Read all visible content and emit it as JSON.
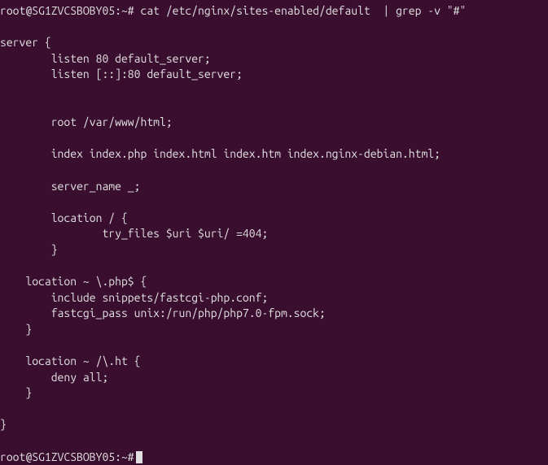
{
  "prompt1": "root@SG1ZVCSBOBY05:~#",
  "command1": " cat /etc/nginx/sites-enabled/default  | grep -v \"#\"",
  "output": {
    "line1": "server {",
    "line2": "        listen 80 default_server;",
    "line3": "        listen [::]:80 default_server;",
    "line4": "",
    "line5": "",
    "line6": "        root /var/www/html;",
    "line7": "",
    "line8": "        index index.php index.html index.htm index.nginx-debian.html;",
    "line9": "",
    "line10": "        server_name _;",
    "line11": "",
    "line12": "        location / {",
    "line13": "                try_files $uri $uri/ =404;",
    "line14": "        }",
    "line15": "",
    "line16": "    location ~ \\.php$ {",
    "line17": "        include snippets/fastcgi-php.conf;",
    "line18": "        fastcgi_pass unix:/run/php/php7.0-fpm.sock;",
    "line19": "    }",
    "line20": "",
    "line21": "    location ~ /\\.ht {",
    "line22": "        deny all;",
    "line23": "    }",
    "line24": "",
    "line25": "}",
    "line26": ""
  },
  "prompt2": "root@SG1ZVCSBOBY05:~#"
}
